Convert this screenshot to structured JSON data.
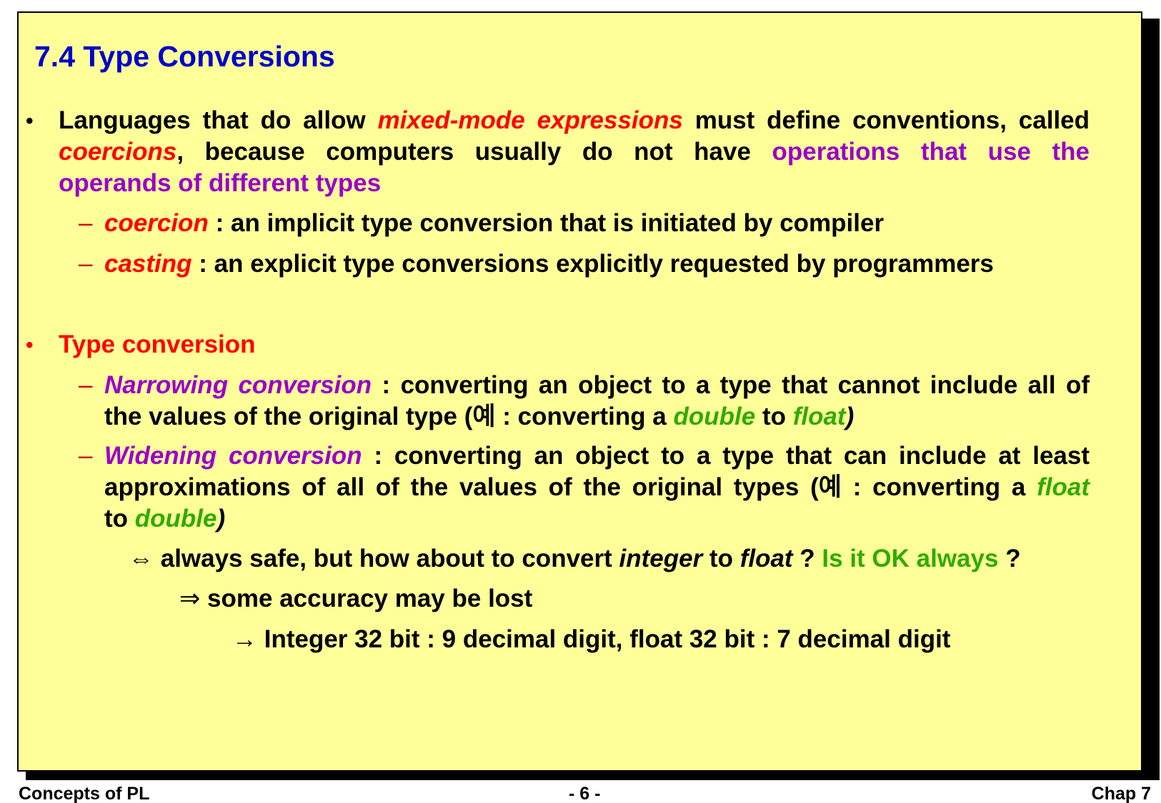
{
  "slide": {
    "title": "7.4 Type Conversions",
    "bullet_marker": "•",
    "dash_marker": "–",
    "bullet1": {
      "l1_a": "Languages that do allow ",
      "l1_b": "mixed-mode expressions",
      "l1_c": " must define conventions, called",
      "l2_a": "coercions",
      "l2_b": ", because computers usually do not have ",
      "l2_c": "operations that use the",
      "l3": "operands of different types"
    },
    "sub1": {
      "term": "coercion",
      "text": " : an implicit type conversion that is initiated by compiler"
    },
    "sub2": {
      "term": "casting",
      "text": " : an explicit type conversions explicitly requested by programmers"
    },
    "bullet2": {
      "heading": "Type conversion"
    },
    "narrowing": {
      "term": "Narrowing conversion",
      "l1_rest": " : converting an object to a type that cannot include all of",
      "l2_a": "the values of the original type (예 : converting a ",
      "l2_b": "double",
      "l2_c": " to ",
      "l2_d": "float",
      "l2_e": ")"
    },
    "widening": {
      "term": "Widening conversion",
      "l1_rest": " : converting an object to a type that can include at least",
      "l2_a": "approximations of all of the values of the original types (예 :  converting a ",
      "l2_b": "float",
      "l3_a": "to ",
      "l3_b": "double",
      "l3_c": ")"
    },
    "note1": {
      "symbol": "⇔",
      "a": " always safe, but how about to convert ",
      "b": "integer",
      "c": " to ",
      "d": "float",
      "e": " ? ",
      "f": "Is it OK always",
      "g": " ?"
    },
    "note2": {
      "symbol": "⇒",
      "text": " some accuracy may be lost"
    },
    "note3": {
      "symbol": "→",
      "text": " Integer 32 bit : 9 decimal digit, float 32 bit : 7 decimal digit"
    }
  },
  "footer": {
    "left": "Concepts of PL",
    "center": "- 6 -",
    "right": "Chap 7"
  },
  "colors": {
    "background": "#ffff99",
    "title": "#0000cc",
    "emphasis_red": "#ff0000",
    "emphasis_purple": "#9900cc",
    "emphasis_green": "#33aa00"
  }
}
